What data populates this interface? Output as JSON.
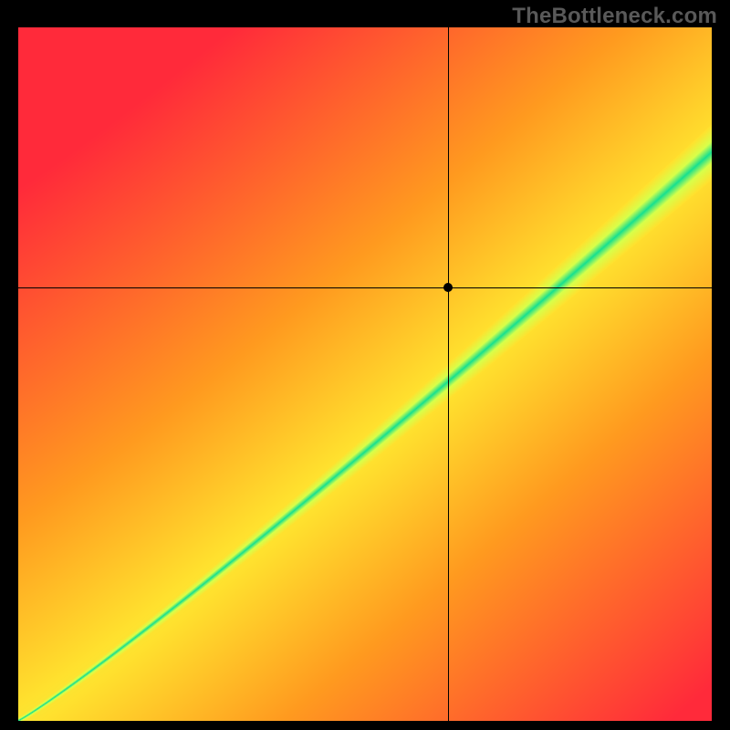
{
  "watermark": "TheBottleneck.com",
  "chart_data": {
    "type": "heatmap",
    "title": "",
    "xlabel": "",
    "ylabel": "",
    "xlim": [
      0,
      1
    ],
    "ylim": [
      0,
      1
    ],
    "crosshair": {
      "x": 0.62,
      "y": 0.625
    },
    "marker": {
      "x": 0.62,
      "y": 0.625
    },
    "optimal_band": {
      "description": "green diagonal band where ratio is balanced",
      "slope_approx": 0.82,
      "intercept_approx": 0.0,
      "half_width_frac": 0.07
    },
    "color_stops": [
      {
        "t": 0.0,
        "color": "#ff2a3a"
      },
      {
        "t": 0.45,
        "color": "#ff9a1f"
      },
      {
        "t": 0.7,
        "color": "#ffe12e"
      },
      {
        "t": 0.88,
        "color": "#d7ff4a"
      },
      {
        "t": 1.0,
        "color": "#18e08f"
      }
    ],
    "grid": false,
    "legend": false
  }
}
